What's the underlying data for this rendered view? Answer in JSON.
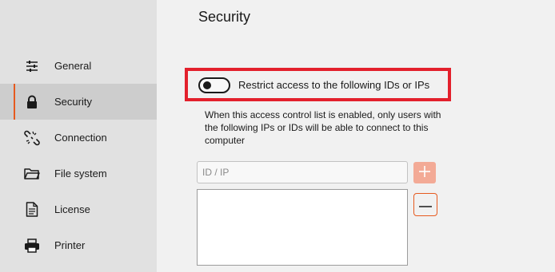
{
  "sidebar": {
    "items": [
      {
        "label": "General",
        "icon": "sliders-icon",
        "active": false
      },
      {
        "label": "Security",
        "icon": "lock-icon",
        "active": true
      },
      {
        "label": "Connection",
        "icon": "broken-link-icon",
        "active": false
      },
      {
        "label": "File system",
        "icon": "folder-icon",
        "active": false
      },
      {
        "label": "License",
        "icon": "document-icon",
        "active": false
      },
      {
        "label": "Printer",
        "icon": "printer-icon",
        "active": false
      }
    ]
  },
  "main": {
    "title": "Security",
    "access_control": {
      "toggle_label": "Restrict access to the following IDs or IPs",
      "toggle_on": false,
      "description": "When this access control list is enabled, only users with the following IPs or IDs will be able to connect to this computer"
    },
    "id_input": {
      "placeholder": "ID / IP",
      "value": ""
    },
    "add_button_icon": "plus-icon",
    "remove_button_icon": "minus-icon",
    "list_items": []
  },
  "colors": {
    "accent": "#e65a1f",
    "highlight_border": "#e3202c",
    "add_button_bg": "#f3aa96",
    "sidebar_bg": "#e1e1e1",
    "sidebar_active_bg": "#cdcdcd",
    "main_bg": "#f1f1f1"
  }
}
